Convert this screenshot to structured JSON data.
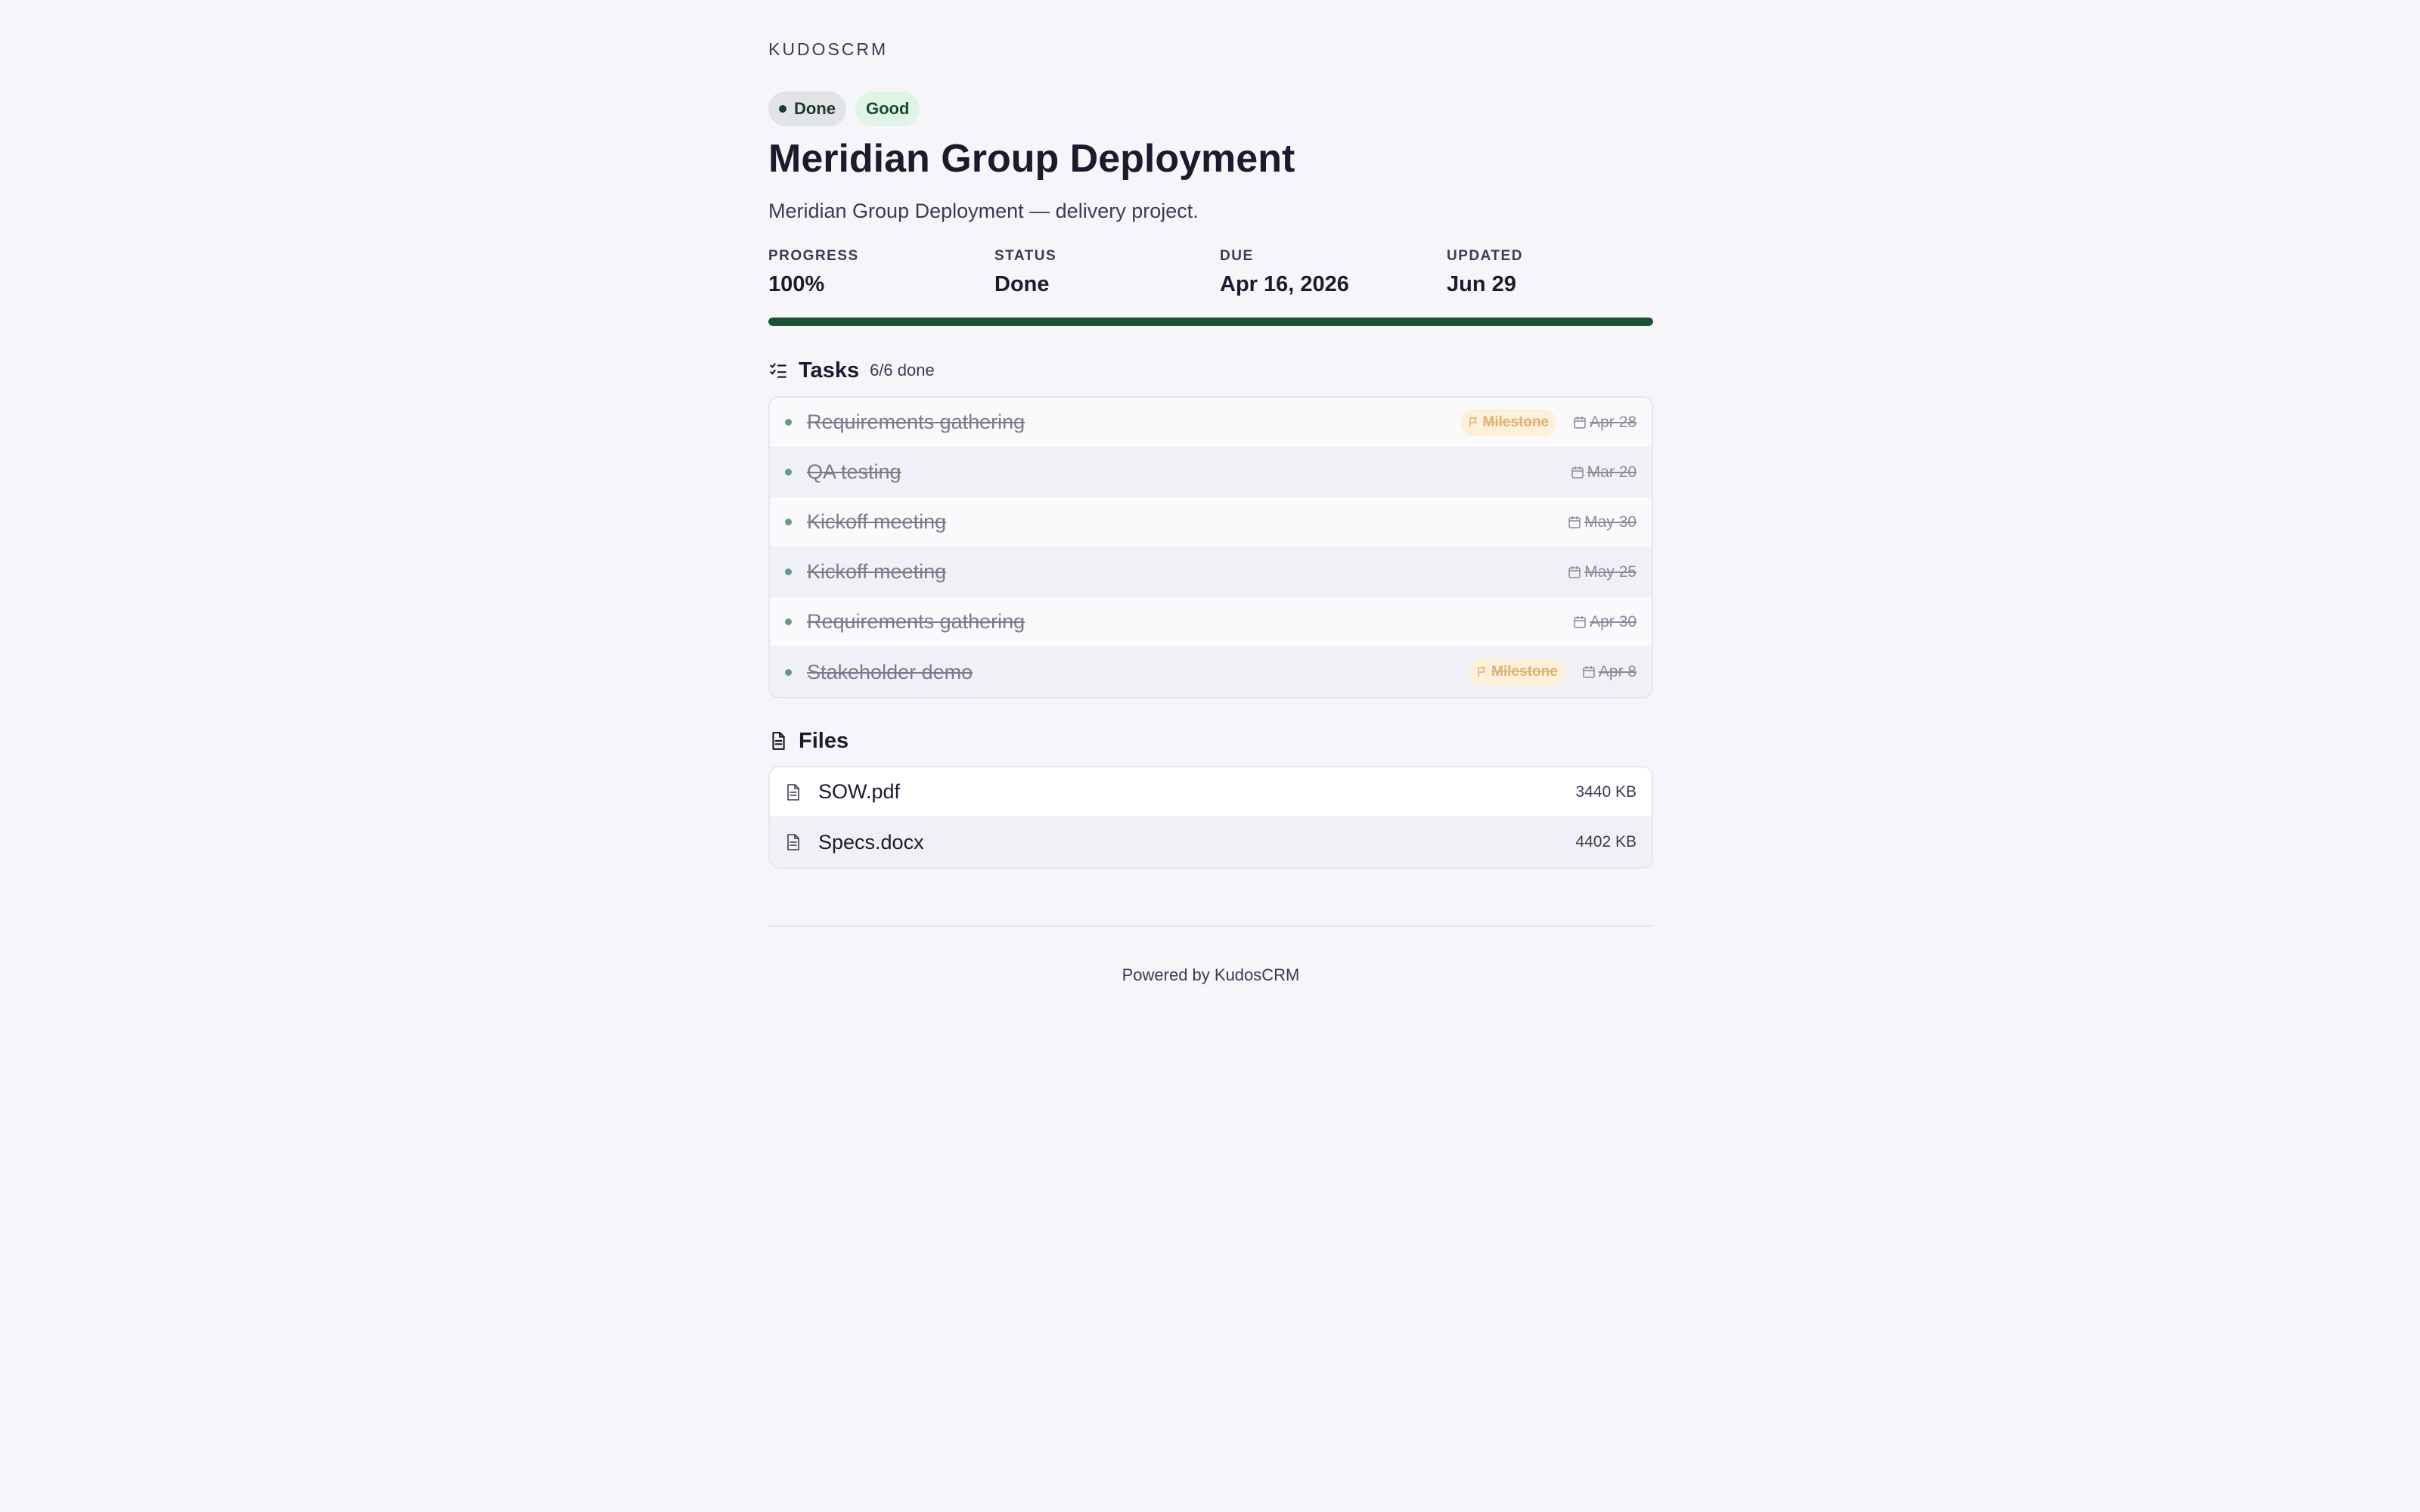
{
  "brand": "KUDOSCRM",
  "badges": {
    "status": "Done",
    "health": "Good"
  },
  "project": {
    "title": "Meridian Group Deployment",
    "description": "Meridian Group Deployment — delivery project."
  },
  "stats": {
    "progress_label": "PROGRESS",
    "progress_value": "100%",
    "status_label": "STATUS",
    "status_value": "Done",
    "due_label": "DUE",
    "due_value": "Apr 16, 2026",
    "updated_label": "UPDATED",
    "updated_value": "Jun 29"
  },
  "progress_fraction": 1.0,
  "tasks": {
    "title": "Tasks",
    "count": "6/6 done",
    "items": [
      {
        "name": "Requirements gathering",
        "milestone": "Milestone",
        "due": "Apr 28"
      },
      {
        "name": "QA testing",
        "milestone": "",
        "due": "Mar 20"
      },
      {
        "name": "Kickoff meeting",
        "milestone": "",
        "due": "May 30"
      },
      {
        "name": "Kickoff meeting",
        "milestone": "",
        "due": "May 25"
      },
      {
        "name": "Requirements gathering",
        "milestone": "",
        "due": "Apr 30"
      },
      {
        "name": "Stakeholder demo",
        "milestone": "Milestone",
        "due": "Apr 8"
      }
    ]
  },
  "files": {
    "title": "Files",
    "items": [
      {
        "name": "SOW.pdf",
        "size": "3440 KB"
      },
      {
        "name": "Specs.docx",
        "size": "4402 KB"
      }
    ]
  },
  "footer": "Powered by KudosCRM",
  "colors": {
    "progress_fill": "#1b5232",
    "status_badge_bg": "#e1e3e6",
    "health_badge_bg": "#dff4e6",
    "milestone_bg": "#fdf1dc",
    "milestone_text": "#e0b070"
  }
}
